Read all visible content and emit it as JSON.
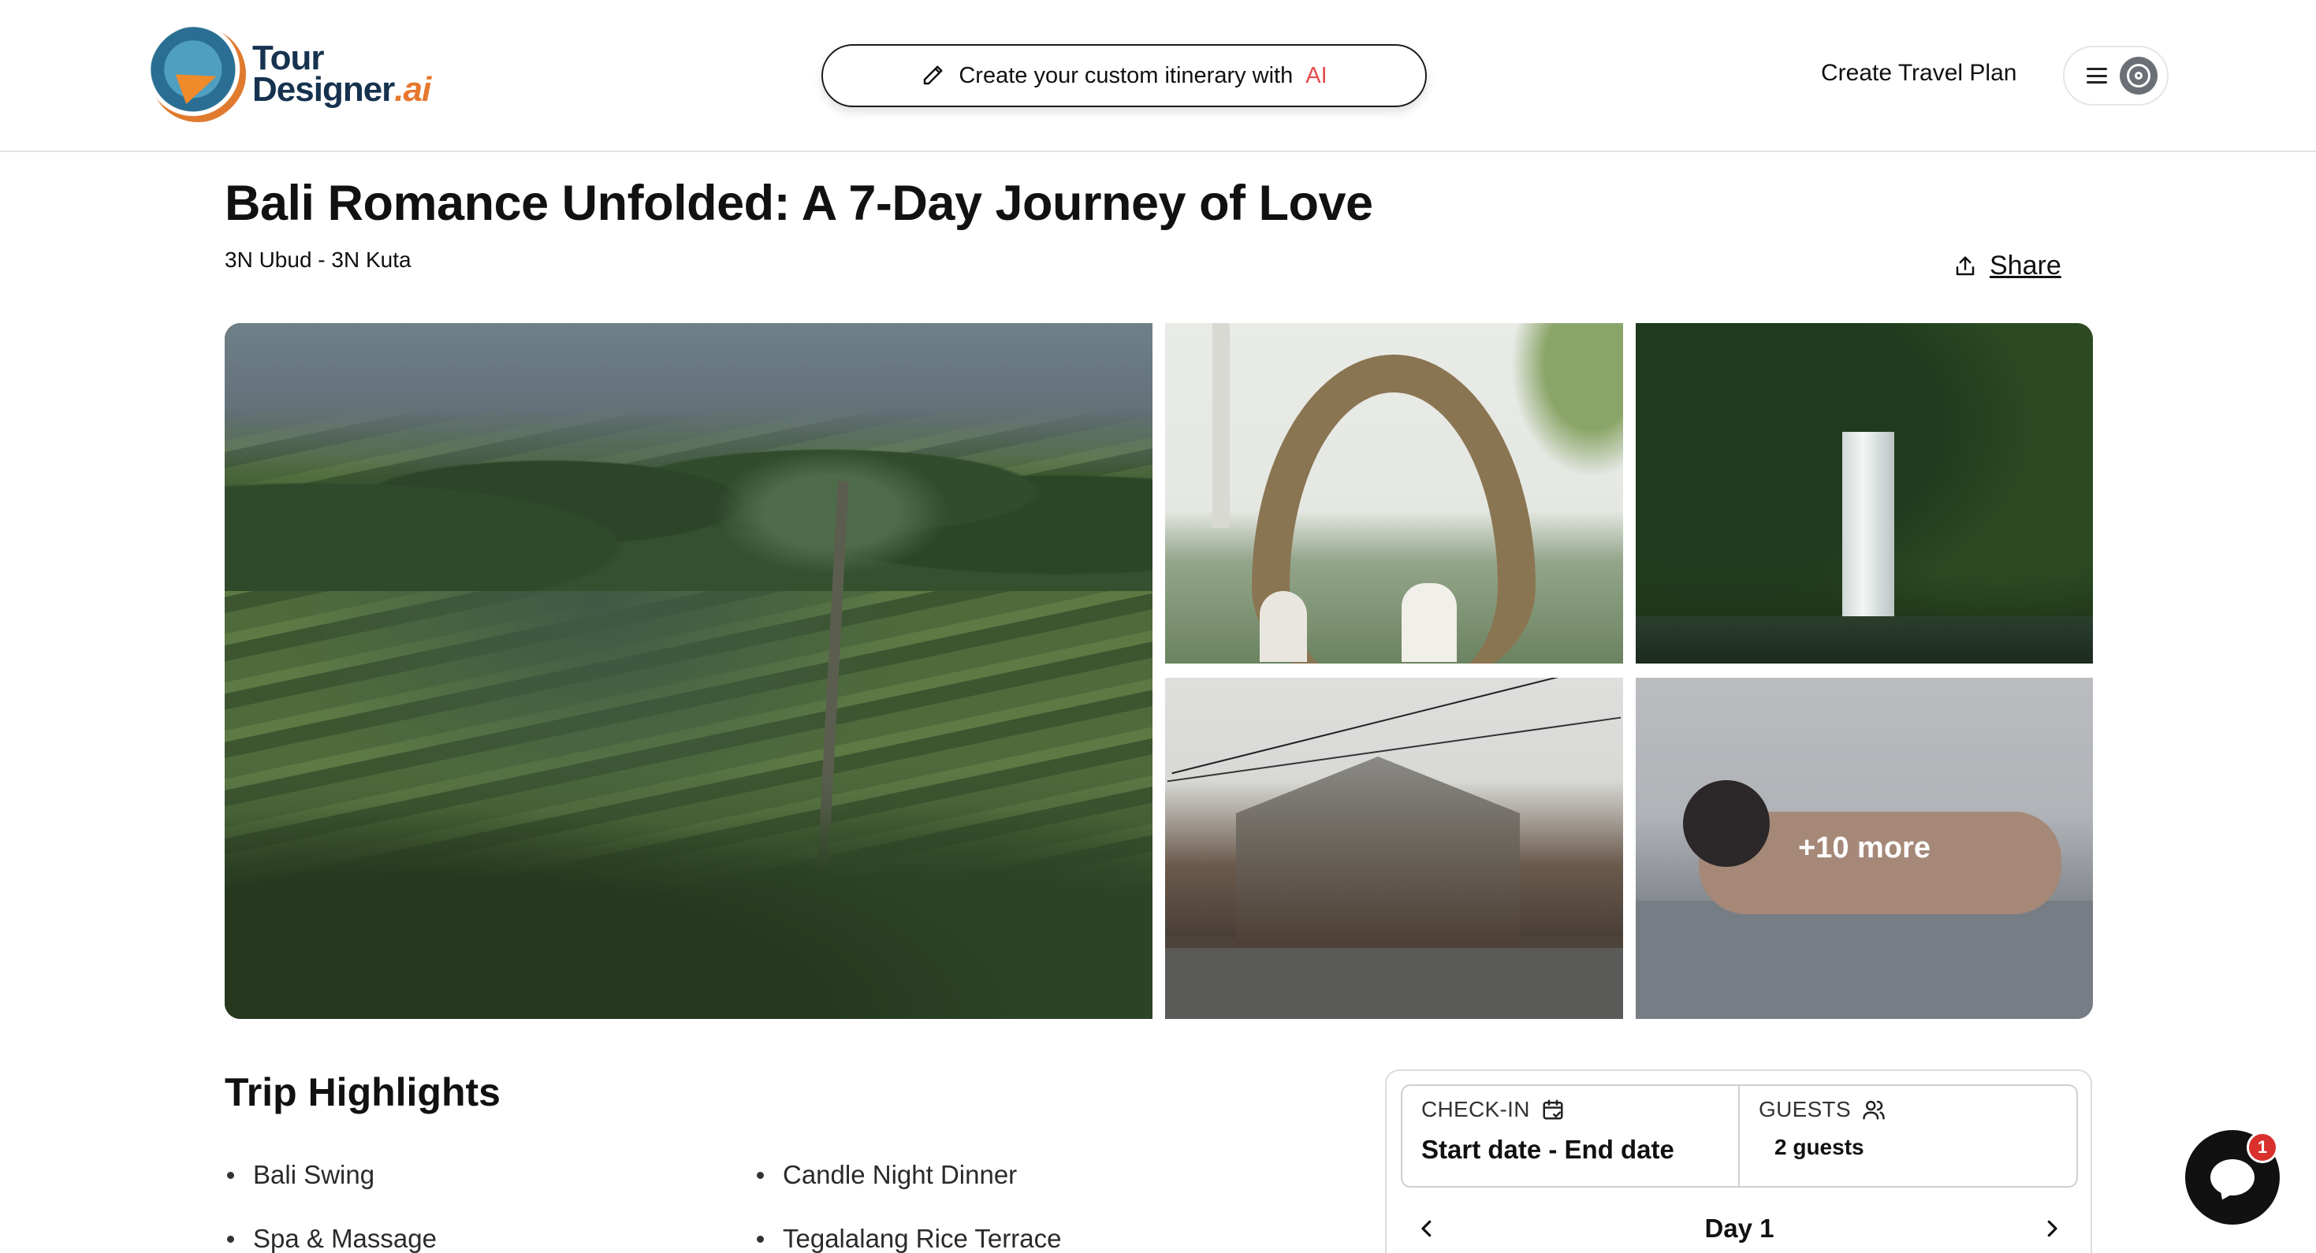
{
  "header": {
    "logo_line1": "Tour",
    "logo_line2": "Designer",
    "logo_suffix": ".ai",
    "ai_pill_text": "Create your custom itinerary with",
    "ai_pill_accent": "AI",
    "create_plan_label": "Create Travel Plan"
  },
  "trip": {
    "title": "Bali Romance Unfolded: A 7-Day Journey of Love",
    "route": "3N Ubud - 3N Kuta",
    "share_label": "Share"
  },
  "gallery": {
    "more_label": "+10 more"
  },
  "highlights": {
    "title": "Trip Highlights",
    "items": [
      "Bali Swing",
      "Candle Night Dinner",
      "Spa & Massage",
      "Tegalalang Rice Terrace"
    ]
  },
  "booking": {
    "checkin_label": "CHECK-IN",
    "checkin_value": "Start date - End date",
    "guests_label": "GUESTS",
    "guests_value": "2 guests",
    "day_label": "Day 1"
  },
  "chat": {
    "badge_count": "1"
  },
  "colors": {
    "brand_navy": "#16324f",
    "brand_orange": "#e8772e",
    "ai_accent": "#e24b4b",
    "badge_red": "#d9302d"
  },
  "icons": [
    "pencil-icon",
    "hamburger-icon",
    "user-avatar-icon",
    "share-icon",
    "calendar-icon",
    "guests-icon",
    "chevron-left-icon",
    "chevron-right-icon",
    "chat-icon"
  ]
}
